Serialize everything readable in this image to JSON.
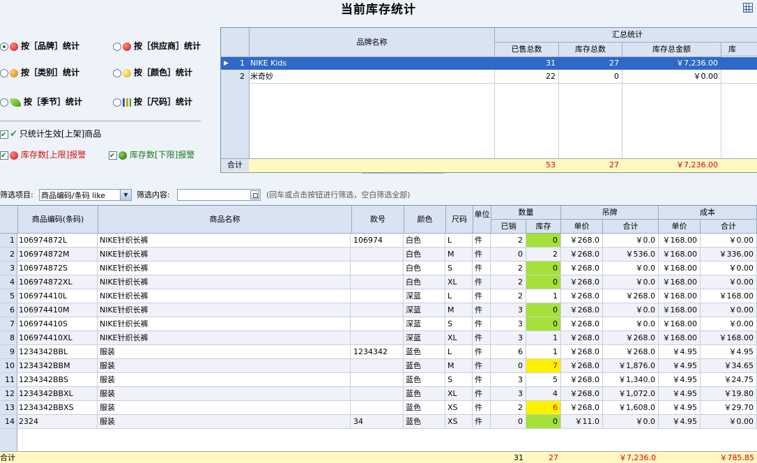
{
  "title": "当前库存统计",
  "options": {
    "brand": "按［品牌］统计",
    "supplier": "按［供应商］统计",
    "category": "按［类别］统计",
    "color": "按［颜色］统计",
    "season": "按［季节］统计",
    "size": "按［尺码］统计",
    "only_active": "只统计生效[上架]商品",
    "upper_alarm": "库存数[上限]报警",
    "lower_alarm": "库存数[下限]报警"
  },
  "summary_grid": {
    "col_brand": "品牌名称",
    "group": "汇总统计",
    "col_sold": "已售总数",
    "col_stock": "库存总数",
    "col_amount": "库存总金额",
    "col_more": "库",
    "rows": [
      {
        "no": "1",
        "brand": "NIKE Kids",
        "sold": "31",
        "stock": "27",
        "amount": "￥7,236.00"
      },
      {
        "no": "2",
        "brand": "米奇妙",
        "sold": "22",
        "stock": "0",
        "amount": "￥0.00"
      }
    ],
    "total_label": "合计",
    "total": {
      "sold": "53",
      "stock": "27",
      "amount": "￥7,236.00"
    }
  },
  "filter": {
    "label": "筛选项目:",
    "selected": "商品编码/条码 like",
    "content_label": "筛选内容:",
    "hint": "(回车或点击按钮进行筛选，空白筛选全部)"
  },
  "detail_grid": {
    "headers": {
      "code": "商品编码(条码)",
      "name": "商品名称",
      "style": "款号",
      "color": "颜色",
      "size": "尺码",
      "unit": "单位",
      "qty": "数量",
      "sold": "已销",
      "stock": "库存",
      "tag": "吊牌",
      "tag_price": "单价",
      "tag_total": "合计",
      "cost": "成本",
      "cost_price": "单价",
      "cost_total": "合计"
    },
    "rows": [
      {
        "no": "1",
        "code": "106974872L",
        "name": "NIKE针织长裤",
        "style": "106974",
        "color": "白色",
        "size": "L",
        "unit": "件",
        "sold": "2",
        "stock": "0",
        "tp": "￥268.0",
        "tt": "￥0.0",
        "cp": "￥168.00",
        "ct": "￥0.00"
      },
      {
        "no": "2",
        "code": "106974872M",
        "name": "NIKE针织长裤",
        "style": "",
        "color": "白色",
        "size": "M",
        "unit": "件",
        "sold": "0",
        "stock": "2",
        "tp": "￥268.0",
        "tt": "￥536.0",
        "cp": "￥168.00",
        "ct": "￥336.00"
      },
      {
        "no": "3",
        "code": "106974872S",
        "name": "NIKE针织长裤",
        "style": "",
        "color": "白色",
        "size": "S",
        "unit": "件",
        "sold": "2",
        "stock": "0",
        "tp": "￥268.0",
        "tt": "￥0.0",
        "cp": "￥168.00",
        "ct": "￥0.00"
      },
      {
        "no": "4",
        "code": "106974872XL",
        "name": "NIKE针织长裤",
        "style": "",
        "color": "白色",
        "size": "XL",
        "unit": "件",
        "sold": "2",
        "stock": "0",
        "tp": "￥268.0",
        "tt": "￥0.0",
        "cp": "￥168.00",
        "ct": "￥0.00"
      },
      {
        "no": "5",
        "code": "106974410L",
        "name": "NIKE针织长裤",
        "style": "",
        "color": "深蓝",
        "size": "L",
        "unit": "件",
        "sold": "2",
        "stock": "1",
        "tp": "￥268.0",
        "tt": "￥268.0",
        "cp": "￥168.00",
        "ct": "￥168.00"
      },
      {
        "no": "6",
        "code": "106974410M",
        "name": "NIKE针织长裤",
        "style": "",
        "color": "深蓝",
        "size": "M",
        "unit": "件",
        "sold": "3",
        "stock": "0",
        "tp": "￥268.0",
        "tt": "￥0.0",
        "cp": "￥168.00",
        "ct": "￥0.00"
      },
      {
        "no": "7",
        "code": "106974410S",
        "name": "NIKE针织长裤",
        "style": "",
        "color": "深蓝",
        "size": "S",
        "unit": "件",
        "sold": "3",
        "stock": "0",
        "tp": "￥268.0",
        "tt": "￥0.0",
        "cp": "￥168.00",
        "ct": "￥0.00"
      },
      {
        "no": "8",
        "code": "106974410XL",
        "name": "NIKE针织长裤",
        "style": "",
        "color": "深蓝",
        "size": "XL",
        "unit": "件",
        "sold": "3",
        "stock": "1",
        "tp": "￥268.0",
        "tt": "￥268.0",
        "cp": "￥168.00",
        "ct": "￥168.00"
      },
      {
        "no": "9",
        "code": "1234342BBL",
        "name": "服装",
        "style": "1234342",
        "color": "蓝色",
        "size": "L",
        "unit": "件",
        "sold": "6",
        "stock": "1",
        "tp": "￥268.0",
        "tt": "￥268.0",
        "cp": "￥4.95",
        "ct": "￥4.95"
      },
      {
        "no": "10",
        "code": "1234342BBM",
        "name": "服装",
        "style": "",
        "color": "蓝色",
        "size": "M",
        "unit": "件",
        "sold": "0",
        "stock": "7",
        "tp": "￥268.0",
        "tt": "￥1,876.0",
        "cp": "￥4.95",
        "ct": "￥34.65"
      },
      {
        "no": "11",
        "code": "1234342BBS",
        "name": "服装",
        "style": "",
        "color": "蓝色",
        "size": "S",
        "unit": "件",
        "sold": "3",
        "stock": "5",
        "tp": "￥268.0",
        "tt": "￥1,340.0",
        "cp": "￥4.95",
        "ct": "￥24.75"
      },
      {
        "no": "12",
        "code": "1234342BBXL",
        "name": "服装",
        "style": "",
        "color": "蓝色",
        "size": "XL",
        "unit": "件",
        "sold": "3",
        "stock": "4",
        "tp": "￥268.0",
        "tt": "￥1,072.0",
        "cp": "￥4.95",
        "ct": "￥19.80"
      },
      {
        "no": "13",
        "code": "1234342BBXS",
        "name": "服装",
        "style": "",
        "color": "蓝色",
        "size": "XS",
        "unit": "件",
        "sold": "2",
        "stock": "6",
        "tp": "￥268.0",
        "tt": "￥1,608.0",
        "cp": "￥4.95",
        "ct": "￥29.70"
      },
      {
        "no": "14",
        "code": "2324",
        "name": "服装",
        "style": "34",
        "color": "蓝色",
        "size": "XS",
        "unit": "件",
        "sold": "0",
        "stock": "0",
        "tp": "￥11.0",
        "tt": "￥0.0",
        "cp": "￥4.95",
        "ct": "￥0.00"
      }
    ],
    "total_label": "合计",
    "total": {
      "sold": "31",
      "stock": "27",
      "tag_total": "￥7,236.0",
      "cost_total": "￥785.85"
    }
  },
  "stock_highlight": {
    "green": "#a6e03a",
    "yellow": "#fff200",
    "alarm_text": "#e00000"
  }
}
